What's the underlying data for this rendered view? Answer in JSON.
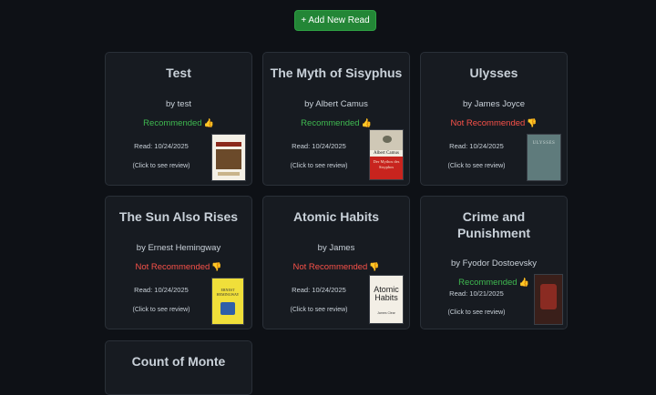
{
  "add_button": "+ Add New Read",
  "books": [
    {
      "title": "Test",
      "author": "by test",
      "rec": "Recommended",
      "thumb": "👍",
      "read": "Read: 10/24/2025",
      "click": "(Click to see review)"
    },
    {
      "title": "The Myth of Sisyphus",
      "author": "by Albert Camus",
      "rec": "Recommended",
      "thumb": "👍",
      "read": "Read: 10/24/2025",
      "click": "(Click to see review)",
      "cover_text": "Albert Camus",
      "cover_sub": "Der Mythos des Sisyphos"
    },
    {
      "title": "Ulysses",
      "author": "by James Joyce",
      "rec": "Not Recommended",
      "thumb": "👎",
      "read": "Read: 10/24/2025",
      "click": "(Click to see review)",
      "cover_text": "ULYSSES"
    },
    {
      "title": "The Sun Also Rises",
      "author": "by Ernest Hemingway",
      "rec": "Not Recommended",
      "thumb": "👎",
      "read": "Read: 10/24/2025",
      "click": "(Click to see review)",
      "cover_text": "ERNEST HEMINGWAY"
    },
    {
      "title": "Atomic Habits",
      "author": "by James",
      "rec": "Not Recommended",
      "thumb": "👎",
      "read": "Read: 10/24/2025",
      "click": "(Click to see review)",
      "cover_text": "Atomic Habits",
      "cover_sub": "James Clear"
    },
    {
      "title": "Crime and Punishment",
      "author": "by Fyodor Dostoevsky",
      "rec": "Recommended",
      "thumb": "👍",
      "read": "Read: 10/21/2025",
      "click": "(Click to see review)"
    },
    {
      "title": "Count of Monte"
    }
  ],
  "colors": {
    "recommended": "#3fb950",
    "not_recommended": "#f85149",
    "accent": "#238636"
  }
}
